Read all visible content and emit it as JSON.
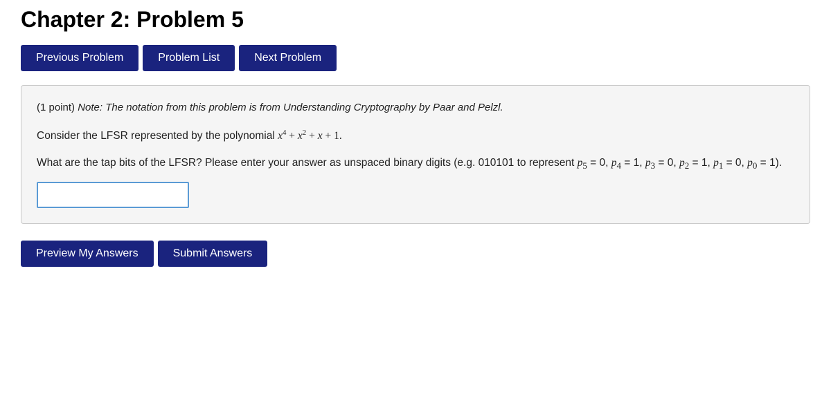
{
  "header": {
    "title": "Chapter 2: Problem 5"
  },
  "nav": {
    "previous_label": "Previous Problem",
    "list_label": "Problem List",
    "next_label": "Next Problem"
  },
  "problem": {
    "points": "(1 point)",
    "note_italic": "Note: The notation from this problem is from Understanding Cryptography by Paar and Pelzl.",
    "main_text": "Consider the LFSR represented by the polynomial",
    "question_intro": "What are the tap bits of the LFSR? Please enter your answer as unspaced binary digits (e.g. 010101 to represent",
    "input_placeholder": "",
    "input_value": ""
  },
  "footer": {
    "preview_label": "Preview My Answers",
    "submit_label": "Submit Answers"
  },
  "colors": {
    "nav_bg": "#1a237e",
    "nav_text": "#ffffff"
  }
}
